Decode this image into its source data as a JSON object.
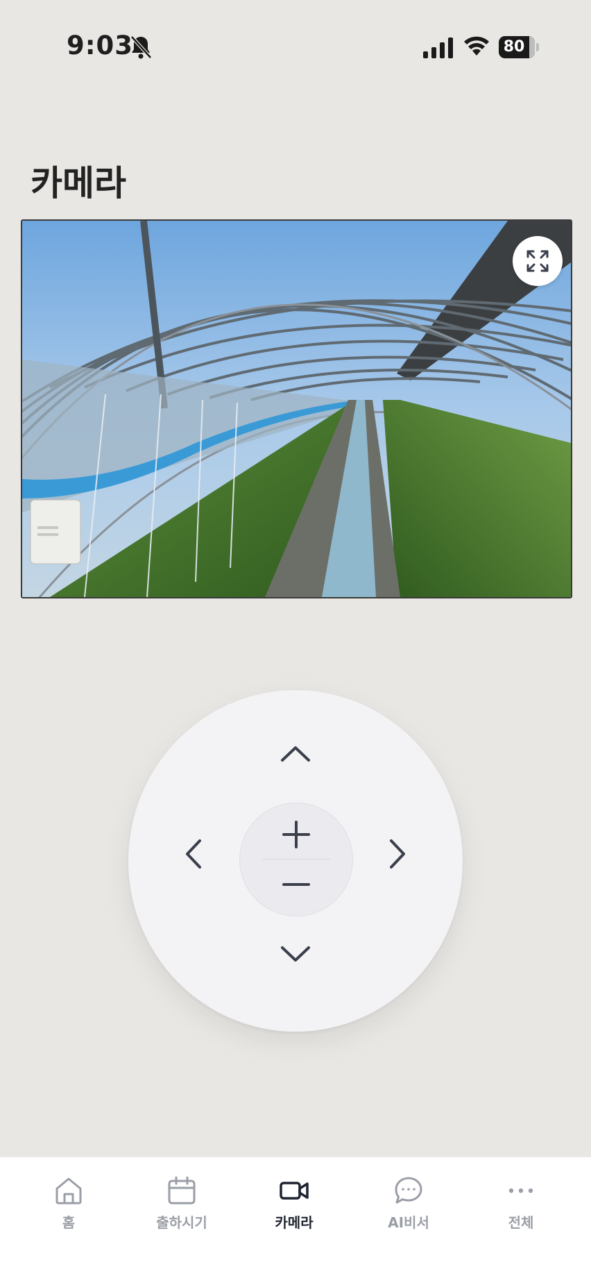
{
  "status_bar": {
    "time": "9:03",
    "battery": "80",
    "icons": [
      "bell-slash-icon",
      "signal-icon",
      "wifi-icon",
      "battery-icon"
    ]
  },
  "page": {
    "title": "카메라"
  },
  "camera": {
    "feed_description_icon": "camera-feed",
    "expand_icon": "expand-icon"
  },
  "ptz": {
    "up_icon": "chevron-up-icon",
    "down_icon": "chevron-down-icon",
    "left_icon": "chevron-left-icon",
    "right_icon": "chevron-right-icon",
    "zoom_in_icon": "plus-icon",
    "zoom_out_icon": "minus-icon"
  },
  "tab_bar": {
    "active": "카메라",
    "tabs": [
      {
        "label": "홈",
        "icon": "home-icon"
      },
      {
        "label": "출하시기",
        "icon": "calendar-icon"
      },
      {
        "label": "카메라",
        "icon": "video-camera-icon"
      },
      {
        "label": "AI비서",
        "icon": "chat-bubble-icon"
      },
      {
        "label": "전체",
        "icon": "more-dots-icon"
      }
    ]
  },
  "colors": {
    "background": "#e9e7e3",
    "pad": "#f3f3f6",
    "icon_dark": "#3a3f4b",
    "tab_inactive": "#9a9ea6",
    "tab_active": "#1e2430"
  }
}
